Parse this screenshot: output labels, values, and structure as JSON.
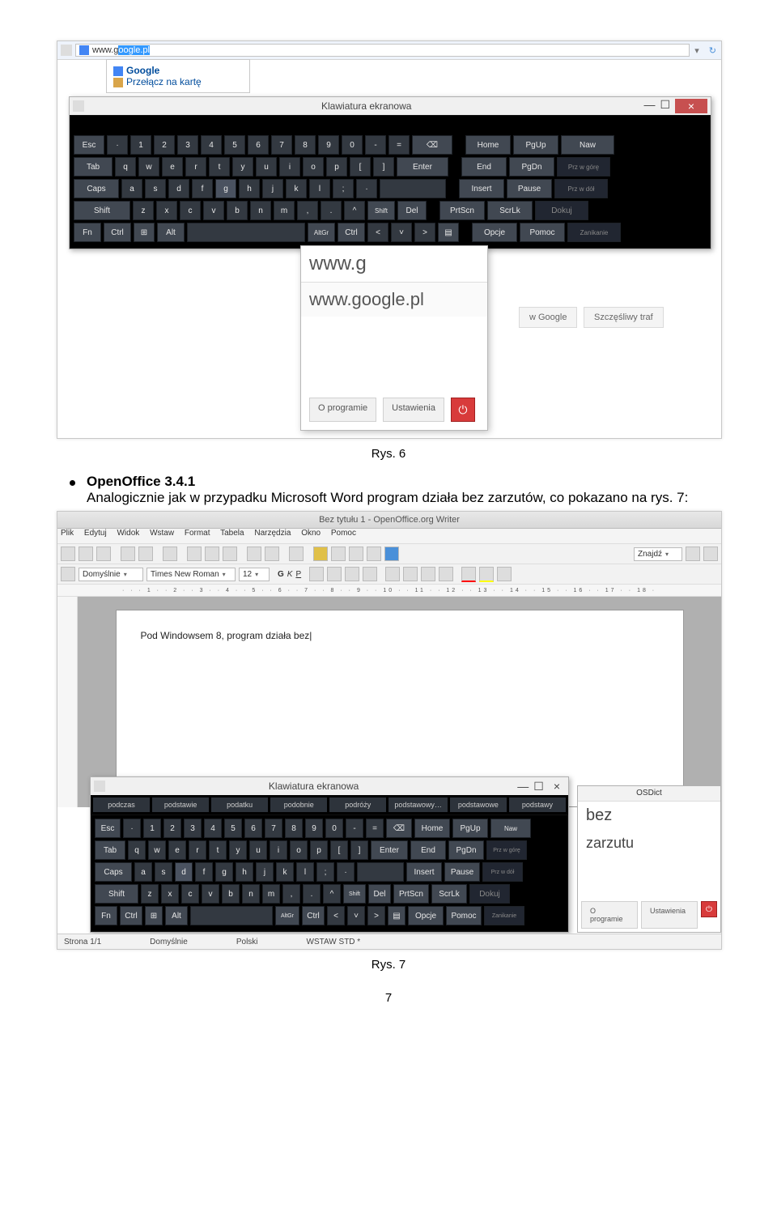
{
  "fig6": {
    "url": "www.google.pl",
    "suggest_title": "Google",
    "suggest_sub": "Przełącz na kartę",
    "keyboard_title": "Klawiatura ekranowa",
    "win_min": "—",
    "win_max": "☐",
    "win_close": "×",
    "rows": {
      "r1": [
        "Esc",
        "·",
        "1",
        "2",
        "3",
        "4",
        "5",
        "6",
        "7",
        "8",
        "9",
        "0",
        "-",
        "=",
        "⌫",
        "",
        "Home",
        "PgUp",
        "Naw"
      ],
      "r2": [
        "Tab",
        "q",
        "w",
        "e",
        "r",
        "t",
        "y",
        "u",
        "i",
        "o",
        "p",
        "[",
        "]",
        "Enter",
        "",
        "End",
        "PgDn",
        "Prz w górę"
      ],
      "r3": [
        "Caps",
        "a",
        "s",
        "d",
        "f",
        "g",
        "h",
        "j",
        "k",
        "l",
        ";",
        "·",
        "",
        "",
        "Insert",
        "Pause",
        "Prz w dół"
      ],
      "r4": [
        "Shift",
        "",
        "z",
        "x",
        "c",
        "v",
        "b",
        "n",
        "m",
        ",",
        ".",
        "^",
        "Shift",
        "Del",
        "",
        "PrtScn",
        "ScrLk",
        "Dokuj"
      ],
      "r5": [
        "Fn",
        "Ctrl",
        "⊞",
        "Alt",
        "",
        "",
        "AltGr",
        "Ctrl",
        "<",
        "˅",
        ">",
        "▤",
        "",
        "Opcje",
        "Pomoc",
        "Zanikanie"
      ]
    },
    "search_typed": "www.g",
    "search_sugg": "www.google.pl",
    "btn_about": "O programie",
    "btn_settings": "Ustawienia",
    "gbtn1": "w Google",
    "gbtn2": "Szczęśliwy traf",
    "caption": "Rys. 6"
  },
  "body": {
    "bullet_title": "OpenOffice 3.4.1",
    "bullet_text": "Analogicznie jak w przypadku Microsoft Word program działa bez zarzutów, co pokazano na rys. 7:"
  },
  "fig7": {
    "title": "Bez tytułu 1 - OpenOffice.org Writer",
    "menus": [
      "Plik",
      "Edytuj",
      "Widok",
      "Wstaw",
      "Format",
      "Tabela",
      "Narzędzia",
      "Okno",
      "Pomoc"
    ],
    "style": "Domyślnie",
    "font": "Times New Roman",
    "size": "12",
    "ruler": "· · · 1 · · 2 · · 3 · · 4 · · 5 · · 6 · · 7 · · 8 · · 9 · · 10 · · 11 · · 12 · · 13 · · 14 · · 15 · · 16 · · 17 · · 18 ·",
    "doc_text": "Pod Windowsem 8, program działa bez|",
    "keyboard_title": "Klawiatura ekranowa",
    "wsugg": [
      "podczas",
      "podstawie",
      "podatku",
      "podobnie",
      "podróży",
      "podstawowy…",
      "podstawowe",
      "podstawy"
    ],
    "rows": {
      "r1": [
        "Esc",
        "·",
        "1",
        "2",
        "3",
        "4",
        "5",
        "6",
        "7",
        "8",
        "9",
        "0",
        "-",
        "=",
        "⌫",
        "Home",
        "PgUp",
        "Naw"
      ],
      "r2": [
        "Tab",
        "q",
        "w",
        "e",
        "r",
        "t",
        "y",
        "u",
        "i",
        "o",
        "p",
        "[",
        "]",
        "Enter",
        "End",
        "PgDn",
        "Prz w górę"
      ],
      "r3": [
        "Caps",
        "a",
        "s",
        "d",
        "f",
        "g",
        "h",
        "j",
        "k",
        "l",
        ";",
        "·",
        "",
        "Insert",
        "Pause",
        "Prz w dół"
      ],
      "r4": [
        "Shift",
        "",
        "z",
        "x",
        "c",
        "v",
        "b",
        "n",
        "m",
        ",",
        ".",
        "^",
        "Shift",
        "Del",
        "PrtScn",
        "ScrLk",
        "Dokuj"
      ],
      "r5": [
        "Fn",
        "Ctrl",
        "⊞",
        "Alt",
        "",
        "",
        "AltGr",
        "Ctrl",
        "<",
        "˅",
        ">",
        "▤",
        "Opcje",
        "Pomoc",
        "Zanikanie"
      ]
    },
    "dict_title": "OSDict",
    "dict_w1": "bez",
    "dict_w2": "zarzutu",
    "btn_about": "O programie",
    "btn_settings": "Ustawienia",
    "status_page": "Strona 1/1",
    "status_style": "Domyślnie",
    "status_lang": "Polski",
    "status_mode": "WSTAW  STD  *",
    "caption": "Rys. 7"
  },
  "pagenum": "7"
}
